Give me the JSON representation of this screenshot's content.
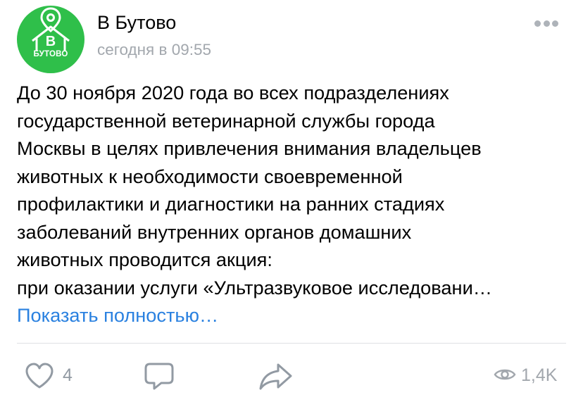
{
  "post": {
    "author": "В Бутово",
    "time": "сегодня в 09:55",
    "avatar": {
      "letter": "В",
      "caption": "БУТОВО",
      "color": "#2fbf4a"
    },
    "text_lines": [
      "До 30 ноября 2020 года во всех подразделениях",
      "государственной ветеринарной службы города",
      "Москвы в целях привлечения внимания владельцев",
      "животных к необходимости своевременной",
      "профилактики и диагностики на ранних стадиях",
      "заболеваний внутренних органов домашних",
      "животных проводится акция:",
      "при оказании услуги «Ультразвуковое исследовани…"
    ],
    "show_more": "Показать полностью…"
  },
  "actions": {
    "likes": "4",
    "views": "1,4K"
  },
  "icons": {
    "more": "more-dots-icon",
    "like": "heart-icon",
    "comment": "comment-icon",
    "share": "share-arrow-icon",
    "views": "eye-icon"
  },
  "colors": {
    "link": "#2a81e0",
    "secondary_text": "#a2a7ad",
    "icon": "#929aa3"
  }
}
